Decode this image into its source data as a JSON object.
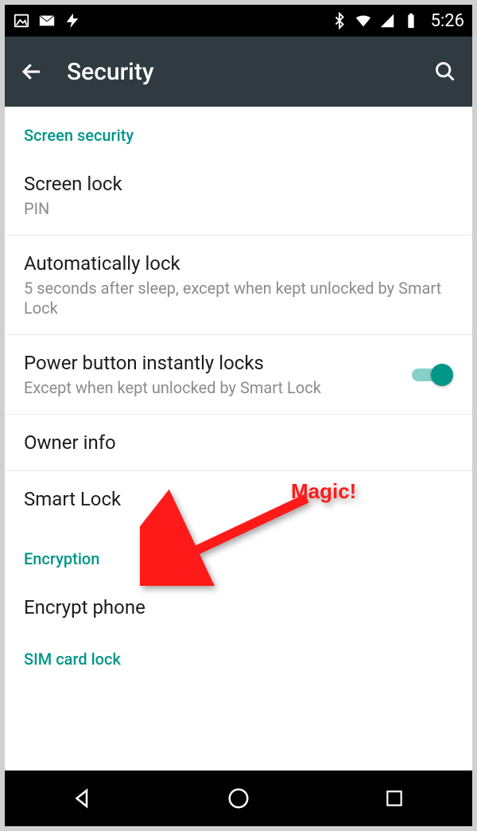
{
  "status": {
    "time": "5:26"
  },
  "appbar": {
    "title": "Security"
  },
  "sections": {
    "screen_security": {
      "header": "Screen security",
      "screen_lock": {
        "title": "Screen lock",
        "subtitle": "PIN"
      },
      "auto_lock": {
        "title": "Automatically lock",
        "subtitle": "5 seconds after sleep, except when kept unlocked by Smart Lock"
      },
      "power_lock": {
        "title": "Power button instantly locks",
        "subtitle": "Except when kept unlocked by Smart Lock",
        "toggle_on": true
      },
      "owner_info": {
        "title": "Owner info"
      },
      "smart_lock": {
        "title": "Smart Lock"
      }
    },
    "encryption": {
      "header": "Encryption",
      "encrypt_phone": {
        "title": "Encrypt phone"
      }
    },
    "sim": {
      "header": "SIM card lock"
    }
  },
  "annotation": {
    "label": "Magic!"
  },
  "colors": {
    "accent": "#009688",
    "appbar": "#2f3b40",
    "arrow": "#ff1a1a"
  }
}
